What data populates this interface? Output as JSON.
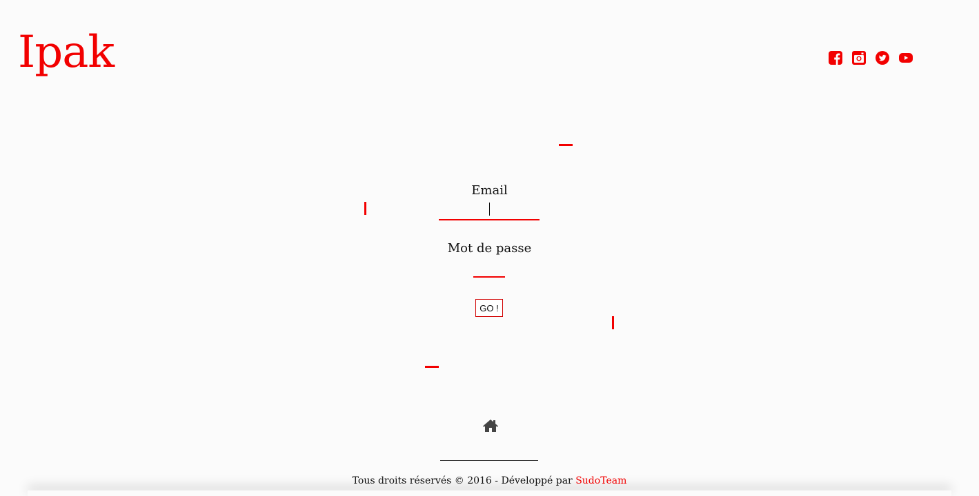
{
  "brand": {
    "logo": "Ipak",
    "color": "#f20000"
  },
  "social": [
    {
      "name": "facebook-icon"
    },
    {
      "name": "instagram-icon"
    },
    {
      "name": "twitter-icon"
    },
    {
      "name": "youtube-icon"
    }
  ],
  "form": {
    "email_label": "Email",
    "email_value": "",
    "password_label": "Mot de passe",
    "password_value": "",
    "submit_label": "GO !"
  },
  "nav": {
    "home_icon": "home-icon"
  },
  "footer": {
    "text": "Tous droits réservés © 2016 - Développé par ",
    "link": "SudoTeam"
  }
}
